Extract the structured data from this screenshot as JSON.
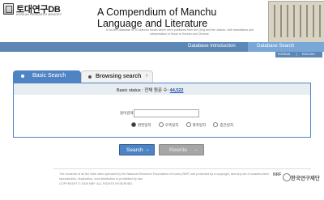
{
  "header": {
    "logo_text": "토대연구DB",
    "logo_sub": "KOREAN RESEARCH MEMORY",
    "title": "A Compendium of Manchu Language and Literature",
    "subtitle": "A full-text database of 20 Manchu books which were published from the Qing and the Joseon, with translations and interpretation of those to Korean and Chinese."
  },
  "nav": {
    "intro": "Database Introduction",
    "search": "Database Search",
    "lang_korean": "KOREAN",
    "lang_sep": "|",
    "lang_english": "ENGLISH"
  },
  "tabs": {
    "basic": "Basic Search",
    "browse": "Browsing search",
    "browse_chevron": "›"
  },
  "status": {
    "label": "Basic status :",
    "total_label": "전체 원문 수:",
    "count": "44,522"
  },
  "form": {
    "field_label": "원어검색 :",
    "field_value": "",
    "options": [
      "완전일치",
      "우측일치",
      "좌측일치",
      "중간일치"
    ]
  },
  "buttons": {
    "search": "Search",
    "search_arrow": "→",
    "rewrite": "Rewrite",
    "rewrite_arrow": "→"
  },
  "footer": {
    "text": "The contents of all the Web sites operated by the National Research Foundation of Korea (NRF) are protected by a copyright, and any act of unauthorized reproduction, duplication, and distribution is prohibited by law.",
    "copyright": "COPYRIGHT © 2009 NRF. ALL RIGHTS RESERVED.",
    "nrf_mark": "NRF",
    "nrf_name": "한국연구재단"
  },
  "colors": {
    "nav_blue": "#5d87b5",
    "tab_blue": "#4f84c4",
    "rewrite_gray": "#a6a6a6"
  }
}
